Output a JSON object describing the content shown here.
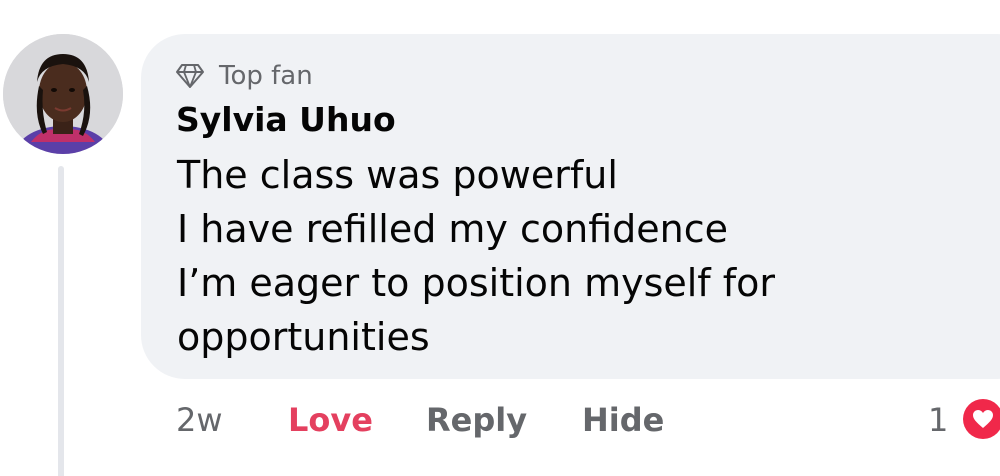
{
  "comment": {
    "badge": {
      "icon": "diamond-icon",
      "label": "Top fan"
    },
    "author": "Sylvia Uhuo",
    "lines": [
      "The class was powerful",
      "I have refilled my confidence",
      "I’m eager to position myself for",
      "opportunities"
    ]
  },
  "actions": {
    "time": "2w",
    "love": "Love",
    "reply": "Reply",
    "hide": "Hide"
  },
  "reactions": {
    "count": "1",
    "icon": "heart-icon"
  },
  "colors": {
    "bubble": "#f0f2f5",
    "love": "#e4405f",
    "muted": "#65676b",
    "heart": "#f0284a"
  }
}
